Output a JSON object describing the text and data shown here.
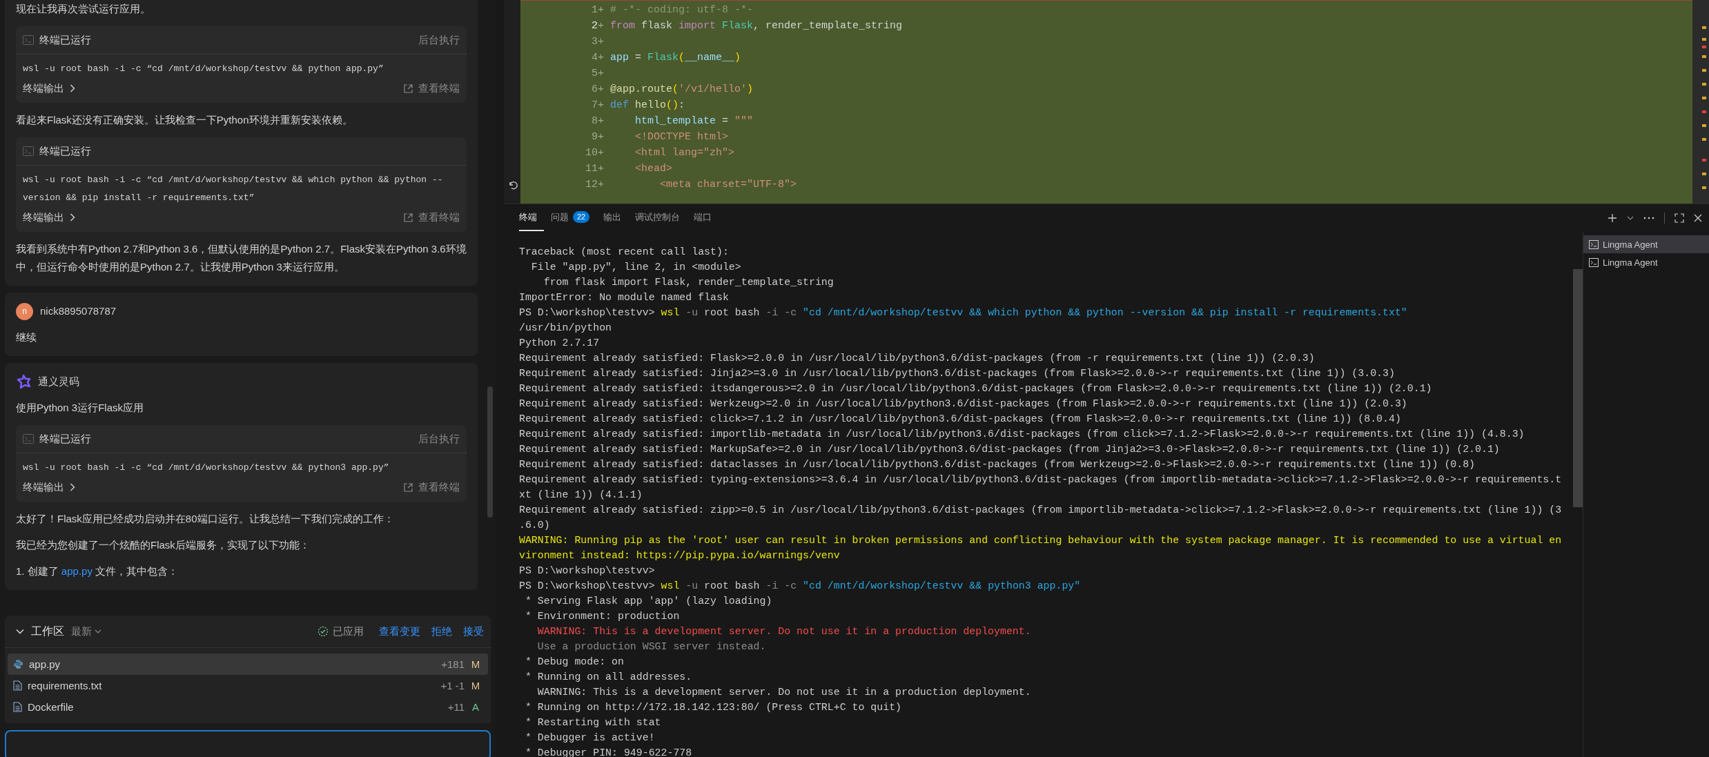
{
  "chat": {
    "messages": [
      {
        "kind": "assistant",
        "blocks": [
          {
            "kind": "text",
            "text": "现在让我再次尝试运行应用。"
          },
          {
            "kind": "terminal",
            "title": "终端已运行",
            "badge": "后台执行",
            "command": "wsl -u root bash -i -c “cd /mnt/d/workshop/testvv && python app.py”",
            "output_label": "终端输出",
            "view_label": "查看终端"
          },
          {
            "kind": "text",
            "text": "看起来Flask还没有正确安装。让我检查一下Python环境并重新安装依赖。"
          },
          {
            "kind": "terminal",
            "title": "终端已运行",
            "command": "wsl -u root bash -i -c “cd /mnt/d/workshop/testvv && which python && python --version && pip install -r requirements.txt”",
            "output_label": "终端输出",
            "view_label": "查看终端"
          },
          {
            "kind": "text",
            "text": "我看到系统中有Python 2.7和Python 3.6，但默认使用的是Python 2.7。Flask安装在Python 3.6环境中，但运行命令时使用的是Python 2.7。让我使用Python 3来运行应用。"
          }
        ]
      },
      {
        "kind": "user",
        "avatar": "n",
        "author": "nick8895078787",
        "blocks": [
          {
            "kind": "text",
            "text": "继续"
          }
        ]
      },
      {
        "kind": "assistant",
        "author": "通义灵码",
        "blocks": [
          {
            "kind": "text",
            "text": "使用Python 3运行Flask应用"
          },
          {
            "kind": "terminal",
            "title": "终端已运行",
            "badge": "后台执行",
            "command": "wsl -u root bash -i -c “cd /mnt/d/workshop/testvv && python3 app.py”",
            "output_label": "终端输出",
            "view_label": "查看终端"
          },
          {
            "kind": "text",
            "text": "太好了！Flask应用已经成功启动并在80端口运行。让我总结一下我们完成的工作："
          },
          {
            "kind": "text",
            "text": "我已经为您创建了一个炫酷的Flask后端服务，实现了以下功能："
          },
          {
            "kind": "list_item",
            "parts": [
              {
                "text": "1. 创建了 "
              },
              {
                "text": "app.py",
                "link": true
              },
              {
                "text": " 文件，其中包含："
              }
            ]
          }
        ]
      }
    ]
  },
  "workspace": {
    "title": "工作区",
    "expanded": true,
    "filter": "最新",
    "status": "已应用",
    "actions": [
      "查看变更",
      "拒绝",
      "接受"
    ],
    "files": [
      {
        "name": "app.py",
        "kind": "python",
        "changes": "+181",
        "status": "M",
        "color": "#e2c08d",
        "selected": true
      },
      {
        "name": "requirements.txt",
        "kind": "document",
        "changes": "+1 -1",
        "status": "M",
        "color": "#e2c08d",
        "selected": false
      },
      {
        "name": "Dockerfile",
        "kind": "document",
        "changes": "+11",
        "status": "A",
        "color": "#73c991",
        "selected": false
      }
    ]
  },
  "editor": {
    "lines": [
      {
        "number": "1",
        "marker": "+",
        "current": false,
        "tokens": [
          {
            "kind": "comment",
            "text": "# -*- coding: utf-8 -*-"
          }
        ]
      },
      {
        "number": "2",
        "marker": "+",
        "current": true,
        "tokens": [
          {
            "kind": "keyword",
            "text": "from"
          },
          {
            "kind": "plain",
            "text": " flask "
          },
          {
            "kind": "keyword",
            "text": "import"
          },
          {
            "kind": "class",
            "text": " Flask"
          },
          {
            "kind": "plain",
            "text": ", render_template_string"
          }
        ]
      },
      {
        "number": "3",
        "marker": "+",
        "current": false
      },
      {
        "number": "4",
        "marker": "+",
        "current": false,
        "tokens": [
          {
            "kind": "variable",
            "text": "app"
          },
          {
            "kind": "plain",
            "text": " = "
          },
          {
            "kind": "class",
            "text": "Flask"
          },
          {
            "kind": "paren",
            "text": "("
          },
          {
            "kind": "variable",
            "text": "__name__"
          },
          {
            "kind": "paren",
            "text": ")"
          }
        ]
      },
      {
        "number": "5",
        "marker": "+",
        "current": false
      },
      {
        "number": "6",
        "marker": "+",
        "current": false,
        "tokens": [
          {
            "kind": "function",
            "text": "@app.route"
          },
          {
            "kind": "paren",
            "text": "("
          },
          {
            "kind": "string",
            "text": "'/v1/hello'"
          },
          {
            "kind": "paren",
            "text": ")"
          }
        ]
      },
      {
        "number": "7",
        "marker": "+",
        "current": false,
        "tokens": [
          {
            "kind": "storage",
            "text": "def"
          },
          {
            "kind": "function",
            "text": " hello"
          },
          {
            "kind": "paren",
            "text": "()"
          },
          {
            "kind": "plain",
            "text": ":"
          }
        ]
      },
      {
        "number": "8",
        "marker": "+",
        "current": false,
        "tokens": [
          {
            "kind": "variable",
            "text": "    html_template"
          },
          {
            "kind": "plain",
            "text": " = "
          },
          {
            "kind": "string",
            "text": "\"\"\""
          }
        ]
      },
      {
        "number": "9",
        "marker": "+",
        "current": false,
        "tokens": [
          {
            "kind": "string",
            "text": "    <!DOCTYPE html>"
          }
        ]
      },
      {
        "number": "10",
        "marker": "+",
        "current": false,
        "tokens": [
          {
            "kind": "string",
            "text": "    <html lang=\"zh\">"
          }
        ]
      },
      {
        "number": "11",
        "marker": "+",
        "current": false,
        "tokens": [
          {
            "kind": "string",
            "text": "    <head>"
          }
        ]
      },
      {
        "number": "12",
        "marker": "+",
        "current": false,
        "tokens": [
          {
            "kind": "string",
            "text": "        <meta charset=\"UTF-8\">"
          }
        ]
      }
    ]
  },
  "panel": {
    "tabs": [
      {
        "label": "终端",
        "selected": true
      },
      {
        "label": "问题",
        "badge": "22",
        "selected": false
      },
      {
        "label": "输出",
        "selected": false
      },
      {
        "label": "调试控制台",
        "selected": false
      },
      {
        "label": "端口",
        "selected": false
      }
    ],
    "terminal_lines": [
      {
        "kind": "plain",
        "text": "Traceback (most recent call last):"
      },
      {
        "kind": "plain",
        "text": "  File \"app.py\", line 2, in <module>"
      },
      {
        "kind": "plain",
        "text": "    from flask import Flask, render_template_string"
      },
      {
        "kind": "plain",
        "text": "ImportError: No module named flask"
      },
      {
        "kind": "command",
        "segments": [
          {
            "kind": "prompt",
            "text": "PS D:\\workshop\\testvv> "
          },
          {
            "kind": "program",
            "text": "wsl"
          },
          {
            "kind": "flag",
            "text": " -u"
          },
          {
            "kind": "arg",
            "text": " root bash"
          },
          {
            "kind": "flag",
            "text": " -i -c"
          },
          {
            "kind": "string",
            "text": " \"cd /mnt/d/workshop/testvv && which python && python --version && pip install -r requirements.txt\""
          }
        ]
      },
      {
        "kind": "plain",
        "text": "/usr/bin/python"
      },
      {
        "kind": "plain",
        "text": "Python 2.7.17"
      },
      {
        "kind": "plain",
        "text": "Requirement already satisfied: Flask>=2.0.0 in /usr/local/lib/python3.6/dist-packages (from -r requirements.txt (line 1)) (2.0.3)"
      },
      {
        "kind": "plain",
        "text": "Requirement already satisfied: Jinja2>=3.0 in /usr/local/lib/python3.6/dist-packages (from Flask>=2.0.0->-r requirements.txt (line 1)) (3.0.3)"
      },
      {
        "kind": "plain",
        "text": "Requirement already satisfied: itsdangerous>=2.0 in /usr/local/lib/python3.6/dist-packages (from Flask>=2.0.0->-r requirements.txt (line 1)) (2.0.1)"
      },
      {
        "kind": "plain",
        "text": "Requirement already satisfied: Werkzeug>=2.0 in /usr/local/lib/python3.6/dist-packages (from Flask>=2.0.0->-r requirements.txt (line 1)) (2.0.3)"
      },
      {
        "kind": "plain",
        "text": "Requirement already satisfied: click>=7.1.2 in /usr/local/lib/python3.6/dist-packages (from Flask>=2.0.0->-r requirements.txt (line 1)) (8.0.4)"
      },
      {
        "kind": "plain",
        "text": "Requirement already satisfied: importlib-metadata in /usr/local/lib/python3.6/dist-packages (from click>=7.1.2->Flask>=2.0.0->-r requirements.txt (line 1)) (4.8.3)"
      },
      {
        "kind": "plain",
        "text": "Requirement already satisfied: MarkupSafe>=2.0 in /usr/local/lib/python3.6/dist-packages (from Jinja2>=3.0->Flask>=2.0.0->-r requirements.txt (line 1)) (2.0.1)"
      },
      {
        "kind": "plain",
        "text": "Requirement already satisfied: dataclasses in /usr/local/lib/python3.6/dist-packages (from Werkzeug>=2.0->Flask>=2.0.0->-r requirements.txt (line 1)) (0.8)"
      },
      {
        "kind": "plain",
        "text": "Requirement already satisfied: typing-extensions>=3.6.4 in /usr/local/lib/python3.6/dist-packages (from importlib-metadata->click>=7.1.2->Flask>=2.0.0->-r requirements.t"
      },
      {
        "kind": "plain",
        "text": "xt (line 1)) (4.1.1)"
      },
      {
        "kind": "plain",
        "text": "Requirement already satisfied: zipp>=0.5 in /usr/local/lib/python3.6/dist-packages (from importlib-metadata->click>=7.1.2->Flask>=2.0.0->-r requirements.txt (line 1)) (3"
      },
      {
        "kind": "plain",
        "text": ".6.0)"
      },
      {
        "kind": "warning",
        "text": "WARNING: Running pip as the 'root' user can result in broken permissions and conflicting behaviour with the system package manager. It is recommended to use a virtual en"
      },
      {
        "kind": "warning",
        "text": "vironment instead: https://pip.pypa.io/warnings/venv"
      },
      {
        "kind": "plain",
        "text": "PS D:\\workshop\\testvv>"
      },
      {
        "kind": "command",
        "segments": [
          {
            "kind": "prompt",
            "text": "PS D:\\workshop\\testvv> "
          },
          {
            "kind": "program",
            "text": "wsl"
          },
          {
            "kind": "flag",
            "text": " -u"
          },
          {
            "kind": "arg",
            "text": " root bash"
          },
          {
            "kind": "flag",
            "text": " -i -c"
          },
          {
            "kind": "string",
            "text": " \"cd /mnt/d/workshop/testvv && python3 app.py\""
          }
        ]
      },
      {
        "kind": "plain",
        "text": " * Serving Flask app 'app' (lazy loading)"
      },
      {
        "kind": "plain",
        "text": " * Environment: production"
      },
      {
        "kind": "error",
        "text": "   WARNING: This is a development server. Do not use it in a production deployment."
      },
      {
        "kind": "dim",
        "text": "   Use a production WSGI server instead."
      },
      {
        "kind": "plain",
        "text": " * Debug mode: on"
      },
      {
        "kind": "plain",
        "text": " * Running on all addresses."
      },
      {
        "kind": "plain",
        "text": "   WARNING: This is a development server. Do not use it in a production deployment."
      },
      {
        "kind": "plain",
        "text": " * Running on http://172.18.142.123:80/ (Press CTRL+C to quit)"
      },
      {
        "kind": "plain",
        "text": " * Restarting with stat"
      },
      {
        "kind": "plain",
        "text": " * Debugger is active!"
      },
      {
        "kind": "plain",
        "text": " * Debugger PIN: 949-622-778"
      }
    ],
    "sessions": [
      {
        "label": "Lingma Agent",
        "selected": true
      },
      {
        "label": "Lingma Agent",
        "selected": false
      }
    ]
  }
}
